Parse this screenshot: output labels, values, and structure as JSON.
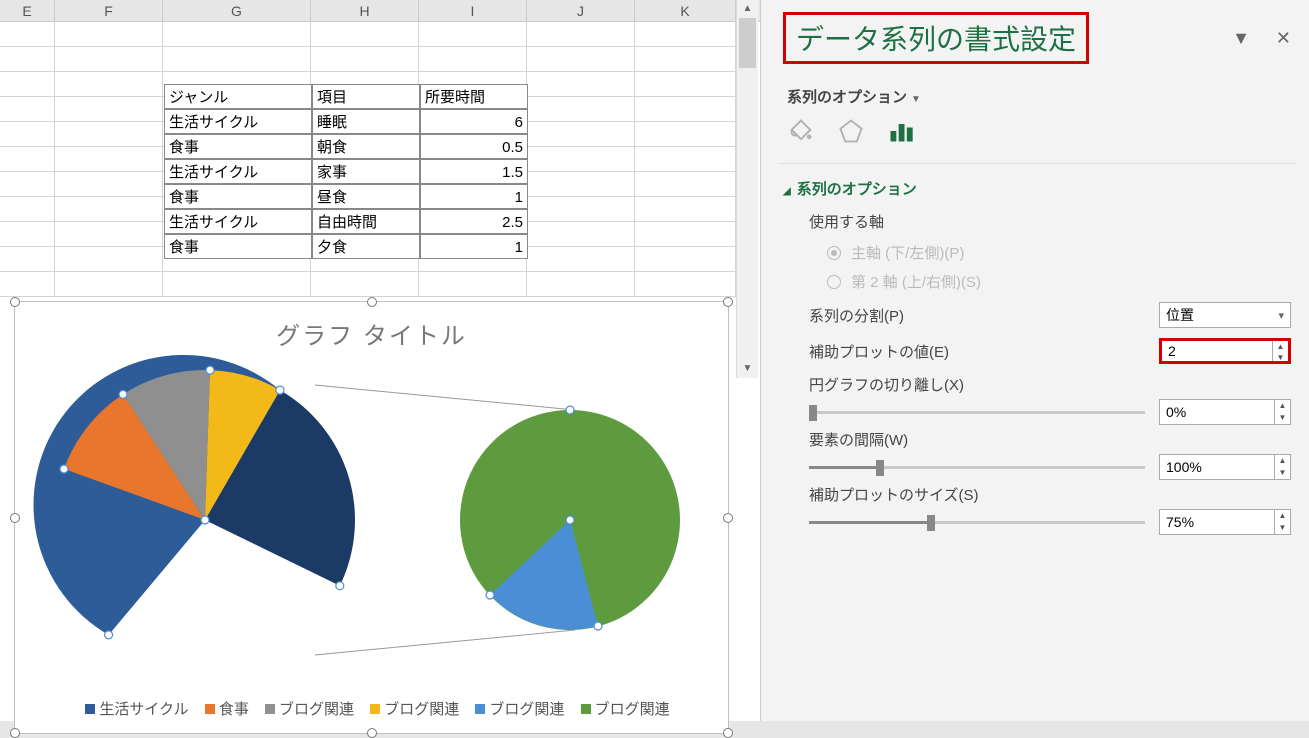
{
  "columns": [
    "E",
    "F",
    "G",
    "H",
    "I",
    "J",
    "K"
  ],
  "table": {
    "headers": [
      "ジャンル",
      "項目",
      "所要時間"
    ],
    "rows": [
      [
        "生活サイクル",
        "睡眠",
        "6"
      ],
      [
        "食事",
        "朝食",
        "0.5"
      ],
      [
        "生活サイクル",
        "家事",
        "1.5"
      ],
      [
        "食事",
        "昼食",
        "1"
      ],
      [
        "生活サイクル",
        "自由時間",
        "2.5"
      ],
      [
        "食事",
        "夕食",
        "1"
      ]
    ]
  },
  "chart": {
    "title": "グラフ タイトル",
    "legend": [
      "生活サイクル",
      "食事",
      "ブログ関連",
      "ブログ関連",
      "ブログ関連",
      "ブログ関連"
    ],
    "legend_colors": [
      "#2e5c99",
      "#e8762d",
      "#8f8f8f",
      "#f3b919",
      "#4a8fd6",
      "#5e9b3e"
    ]
  },
  "chart_data": {
    "type": "pie",
    "title": "グラフ タイトル",
    "subtype": "pie-of-pie",
    "primary": {
      "series": [
        {
          "name": "生活サイクル",
          "value": 47,
          "color": "#2e5c99"
        },
        {
          "name": "食事",
          "value": 9,
          "color": "#e8762d"
        },
        {
          "name": "ブログ関連",
          "value": 12,
          "color": "#8f8f8f"
        },
        {
          "name": "ブログ関連",
          "value": 8,
          "color": "#f3b919"
        },
        {
          "name": "(other)",
          "value": 24,
          "color": "#1b3b66"
        }
      ]
    },
    "secondary": {
      "series": [
        {
          "name": "ブログ関連",
          "value": 18,
          "color": "#4a8fd6"
        },
        {
          "name": "ブログ関連",
          "value": 82,
          "color": "#5e9b3e"
        }
      ]
    },
    "legend": [
      "生活サイクル",
      "食事",
      "ブログ関連",
      "ブログ関連",
      "ブログ関連",
      "ブログ関連"
    ]
  },
  "pane": {
    "title": "データ系列の書式設定",
    "section": "系列のオプション",
    "opt_head": "系列のオプション",
    "axis_label": "使用する軸",
    "axis_primary": "主軸 (下/左側)(P)",
    "axis_secondary": "第 2 軸 (上/右側)(S)",
    "split_label": "系列の分割(P)",
    "split_value": "位置",
    "secondary_size_label": "補助プロットの値(E)",
    "secondary_size_value": "2",
    "explosion_label": "円グラフの切り離し(X)",
    "explosion_value": "0%",
    "gap_label": "要素の間隔(W)",
    "gap_value": "100%",
    "second_plot_label": "補助プロットのサイズ(S)",
    "second_plot_value": "75%"
  }
}
